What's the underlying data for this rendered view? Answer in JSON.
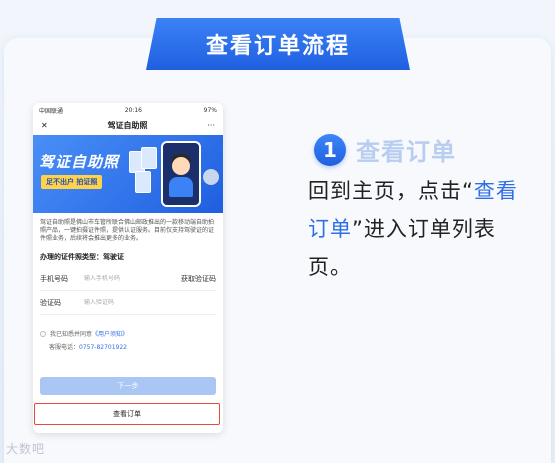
{
  "banner": {
    "title": "查看订单流程"
  },
  "phone": {
    "status": {
      "carrier": "中国联通",
      "time": "20:16",
      "battery": "97%"
    },
    "nav": {
      "close": "✕",
      "title": "驾证自助照",
      "more": "···"
    },
    "hero": {
      "title": "驾证自助照",
      "badge": "足不出户 拍证照"
    },
    "description": "驾证自助照是佛山市车管所联合佛山邮政推出的一款移动端自助拍照产品，一键拍摄证件照，提供认证服务。目前仅支持驾驶证的证件照业务，后续将会推出更多的业务。",
    "form": {
      "type_label": "办理的证件照类型：",
      "type_value": "驾驶证",
      "phone_label": "手机号码",
      "phone_placeholder": "输入手机号码",
      "get_code": "获取验证码",
      "code_label": "验证码",
      "code_placeholder": "输入验证码"
    },
    "agree": {
      "text": "我已知悉并同意",
      "link": "《用户须知》"
    },
    "hotline": {
      "label": "客服电话：",
      "number": "0757-82701922"
    },
    "next_button": "下一步",
    "view_orders_button": "查看订单"
  },
  "step": {
    "number": "1",
    "title": "查看订单",
    "desc_1": "回到主页，点击“",
    "desc_highlight": "查看订单",
    "desc_2": "”进入订单列表页。"
  },
  "watermark": "大数吧"
}
